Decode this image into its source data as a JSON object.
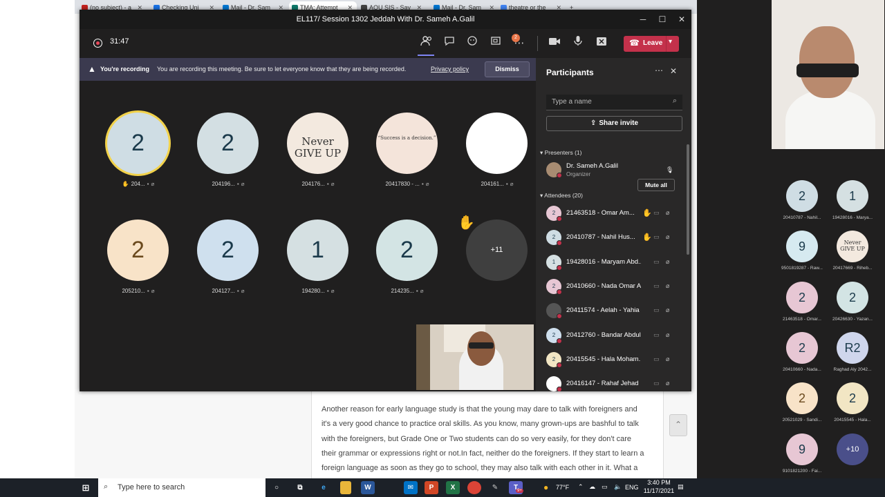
{
  "browser": {
    "tabs": [
      {
        "label": "(no subject) - a",
        "color": "#c5221f"
      },
      {
        "label": "Checking Uni",
        "color": "#1a73e8"
      },
      {
        "label": "Mail - Dr. Sam",
        "color": "#0078d4"
      },
      {
        "label": "TMA: Attempt",
        "color": "#0f7b6c"
      },
      {
        "label": "AOU SIS - Sav",
        "color": "#444444"
      },
      {
        "label": "Mail - Dr. Sam",
        "color": "#0078d4"
      },
      {
        "label": "theatre or the",
        "color": "#4285f4"
      }
    ],
    "new_tab": "+",
    "doc_text": "Another reason for early language study is that the young may dare to talk with foreigners and it's a very good chance to practice oral skills. As you know, many grown-ups are bashful to talk with the foreigners, but Grade One or Two students can do so very easily, for they don't care their grammar or expressions right or not.In fact, neither do the foreigners. If they start to learn a foreign language as soon as they go to school, they may also talk with each other in it. What a"
  },
  "teams": {
    "window_title": "EL117/ Session 1302 Jeddah With Dr. Sameh A.Galil",
    "timer": "31:47",
    "participants_badge": "2",
    "leave_label": "Leave",
    "recording": {
      "title": "You're recording",
      "message": "You are recording this meeting. Be sure to let everyone know that they are being recorded.",
      "privacy_link": "Privacy policy",
      "dismiss": "Dismiss"
    },
    "tiles": [
      {
        "initial": "2",
        "name": "204...",
        "bg": "#cfdde4",
        "hand": true,
        "highlight": true
      },
      {
        "initial": "2",
        "name": "204196...",
        "bg": "#d3dfe3"
      },
      {
        "initial": "",
        "name": "204176...",
        "bg": "#f3e9df",
        "image": "Never GIVE UP"
      },
      {
        "initial": "",
        "name": "20417830 - ...",
        "bg": "#f4e4da",
        "image": "“Success is a decision.”"
      },
      {
        "initial": "",
        "name": "204161...",
        "bg": "#ffffff"
      },
      {
        "initial": "2",
        "name": "205210...",
        "bg": "#f8e3c8",
        "color": "#6b4a1e"
      },
      {
        "initial": "2",
        "name": "204127...",
        "bg": "#cfe0ee"
      },
      {
        "initial": "1",
        "name": "194280...",
        "bg": "#d5e0e2"
      },
      {
        "initial": "2",
        "name": "214235...",
        "bg": "#d3e4e4"
      },
      {
        "initial": "+11",
        "name": "",
        "bg": "#3f3f3f",
        "color": "#ffffff",
        "hand": true
      }
    ]
  },
  "participants": {
    "title": "Participants",
    "search_placeholder": "Type a name",
    "share_invite": "Share invite",
    "presenters_header": "Presenters (1)",
    "presenter": {
      "name": "Dr. Sameh A.Galil",
      "role": "Organizer"
    },
    "attendees_header": "Attendees (20)",
    "mute_all": "Mute all",
    "attendees": [
      {
        "initial": "2",
        "name": "21463518 - Omar Am...",
        "bg": "#e7c7d4",
        "hand": true
      },
      {
        "initial": "2",
        "name": "20410787 - Nahil Hus...",
        "bg": "#cfdde4",
        "hand": true
      },
      {
        "initial": "1",
        "name": "19428016 - Maryam Abd...",
        "bg": "#d5e0e2"
      },
      {
        "initial": "2",
        "name": "20410660 - Nada Omar A...",
        "bg": "#e7c7d4"
      },
      {
        "initial": "",
        "name": "20411574 - Aelah - Yahia",
        "bg": "#555555"
      },
      {
        "initial": "2",
        "name": "20412760 - Bandar Abdul...",
        "bg": "#cfe0ee"
      },
      {
        "initial": "2",
        "name": "20415545 - Hala Moham...",
        "bg": "#f2e6c4"
      },
      {
        "initial": "",
        "name": "20416147 - Rahaf Jehad ...",
        "bg": "#ffffff"
      }
    ]
  },
  "gallery": [
    {
      "initial": "2",
      "label": "20410787 - Nahil...",
      "bg": "#cfdde4"
    },
    {
      "initial": "1",
      "label": "19428016 - Marya...",
      "bg": "#d5e0e2"
    },
    {
      "initial": "9",
      "label": "9501819287 - Raw...",
      "bg": "#d6eaf0"
    },
    {
      "initial": "",
      "label": "20417669 - Riheb...",
      "bg": "#f3e9df",
      "image": "Never GIVE UP"
    },
    {
      "initial": "2",
      "label": "21463518 - Omar...",
      "bg": "#e7c7d4"
    },
    {
      "initial": "2",
      "label": "20426630 - Yazan...",
      "bg": "#d3e4e4"
    },
    {
      "initial": "2",
      "label": "20410660 - Nada...",
      "bg": "#e7c7d4"
    },
    {
      "initial": "R2",
      "label": "Raghad Aly 2042...",
      "bg": "#cfd6ec"
    },
    {
      "initial": "2",
      "label": "20521029 - Sandi...",
      "bg": "#f8e3c8",
      "color": "#6b4a1e"
    },
    {
      "initial": "2",
      "label": "20415545 - Hala...",
      "bg": "#f2e6c4"
    },
    {
      "initial": "9",
      "label": "9101821200 - Fai...",
      "bg": "#e7c7d4"
    },
    {
      "initial": "+10",
      "label": "",
      "bg": "#4a4f8a",
      "color": "#ffffff"
    }
  ],
  "taskbar": {
    "search_placeholder": "Type here to search",
    "weather": "77°F",
    "language": "ENG",
    "time": "3:40 PM",
    "date": "11/17/2021",
    "teams_badge": "9+"
  }
}
